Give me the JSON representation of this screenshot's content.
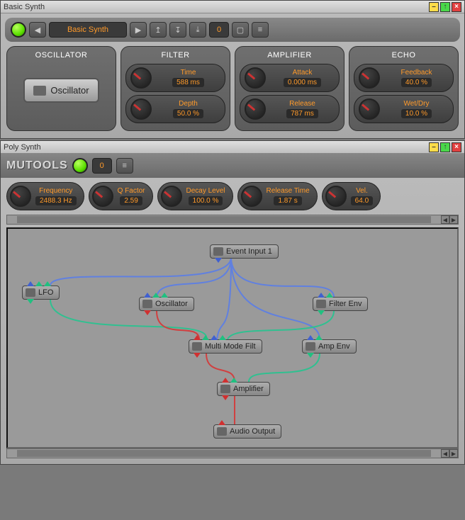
{
  "basic_synth": {
    "title": "Basic Synth",
    "preset_name": "Basic Synth",
    "preset_index": "0",
    "panels": {
      "oscillator": {
        "title": "OSCILLATOR",
        "button": "Oscillator"
      },
      "filter": {
        "title": "FILTER",
        "knobs": [
          {
            "label": "Time",
            "value": "588 ms"
          },
          {
            "label": "Depth",
            "value": "50.0 %"
          }
        ]
      },
      "amplifier": {
        "title": "AMPLIFIER",
        "knobs": [
          {
            "label": "Attack",
            "value": "0.000 ms"
          },
          {
            "label": "Release",
            "value": "787 ms"
          }
        ]
      },
      "echo": {
        "title": "ECHO",
        "knobs": [
          {
            "label": "Feedback",
            "value": "40.0 %"
          },
          {
            "label": "Wet/Dry",
            "value": "10.0 %"
          }
        ]
      }
    }
  },
  "poly_synth": {
    "title": "Poly Synth",
    "brand": "MUTOOLS",
    "preset_index": "0",
    "knobs": [
      {
        "label": "Frequency",
        "value": "2488.3 Hz"
      },
      {
        "label": "Q Factor",
        "value": "2.59"
      },
      {
        "label": "Decay Level",
        "value": "100.0 %"
      },
      {
        "label": "Release Time",
        "value": "1.87 s"
      },
      {
        "label": "Vel.",
        "value": "64.0"
      }
    ],
    "nodes": {
      "event_input": "Event Input 1",
      "lfo": "LFO",
      "oscillator": "Oscillator",
      "filter_env": "Filter Env",
      "multi_mode_filt": "Multi Mode Filt",
      "amp_env": "Amp Env",
      "amplifier": "Amplifier",
      "audio_output": "Audio Output"
    }
  }
}
